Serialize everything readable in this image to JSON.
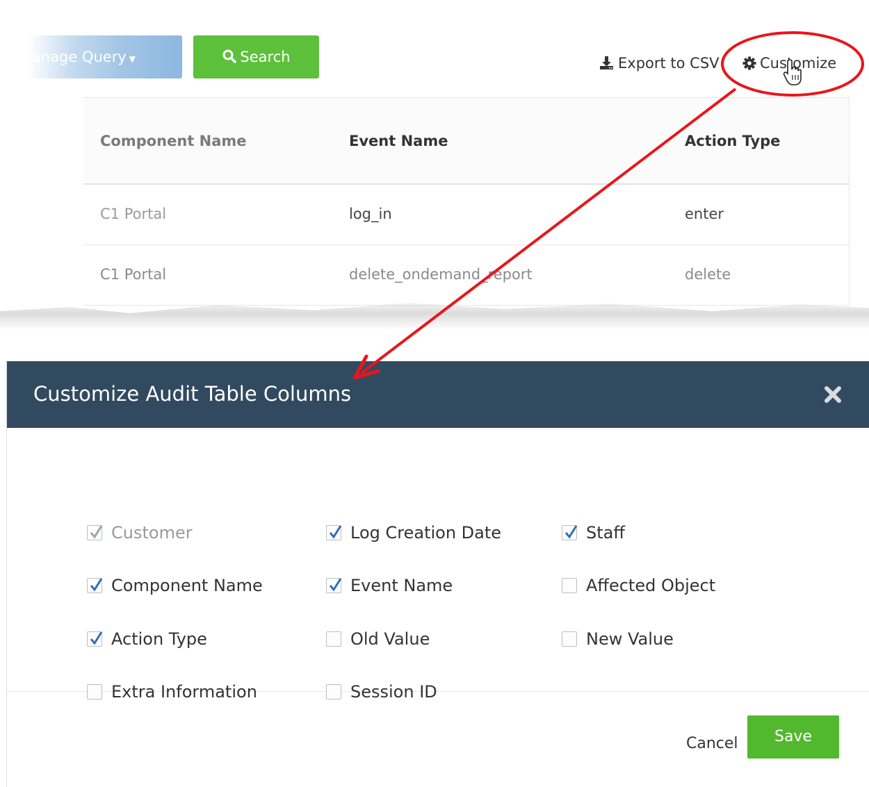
{
  "toolbar": {
    "manage_query_label": "anage Query",
    "search_label": "Search",
    "export_label": "Export to CSV",
    "customize_label": "Customize"
  },
  "audit_table": {
    "headers": [
      "Component Name",
      "Event Name",
      "Action Type"
    ],
    "rows": [
      [
        "C1 Portal",
        "log_in",
        "enter"
      ],
      [
        "C1 Portal",
        "delete_ondemand_report",
        "delete"
      ]
    ]
  },
  "modal": {
    "title": "Customize Audit Table Columns",
    "options": [
      {
        "label": "Customer",
        "checked": true,
        "disabled": true
      },
      {
        "label": "Log Creation Date",
        "checked": true,
        "disabled": false
      },
      {
        "label": "Staff",
        "checked": true,
        "disabled": false
      },
      {
        "label": "Component Name",
        "checked": true,
        "disabled": false
      },
      {
        "label": "Event Name",
        "checked": true,
        "disabled": false
      },
      {
        "label": "Affected Object",
        "checked": false,
        "disabled": false
      },
      {
        "label": "Action Type",
        "checked": true,
        "disabled": false
      },
      {
        "label": "Old Value",
        "checked": false,
        "disabled": false
      },
      {
        "label": "New Value",
        "checked": false,
        "disabled": false
      },
      {
        "label": "Extra Information",
        "checked": false,
        "disabled": false
      },
      {
        "label": "Session ID",
        "checked": false,
        "disabled": false
      }
    ],
    "cancel_label": "Cancel",
    "save_label": "Save"
  },
  "colors": {
    "header_bg": "#324a5f",
    "search_green": "#5dc03a",
    "save_green": "#52b82e",
    "annotation_red": "#e8161b",
    "check_blue": "#2f6fb6"
  },
  "icons": [
    "search-icon",
    "download-icon",
    "gear-icon",
    "hand-cursor-icon",
    "close-icon",
    "check-icon"
  ]
}
